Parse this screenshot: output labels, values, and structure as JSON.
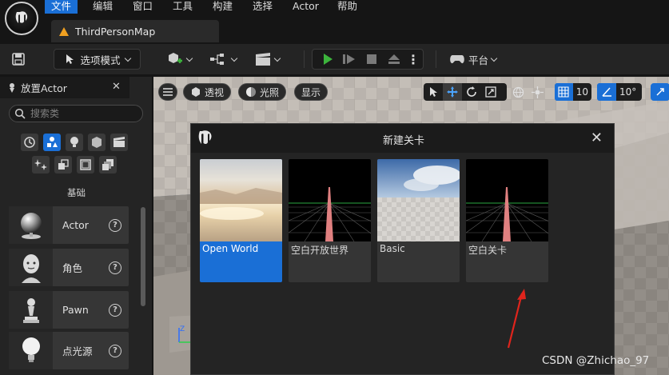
{
  "menu": {
    "items": [
      "文件",
      "编辑",
      "窗口",
      "工具",
      "构建",
      "选择",
      "Actor",
      "帮助"
    ]
  },
  "tab": {
    "title": "ThirdPersonMap"
  },
  "toolbar": {
    "mode_label": "选项模式",
    "platform_label": "平台"
  },
  "left_panel": {
    "title": "放置Actor",
    "search_placeholder": "搜索类",
    "section_label": "基础",
    "items": [
      {
        "label": "Actor",
        "icon": "sphere-icon"
      },
      {
        "label": "角色",
        "icon": "character-icon"
      },
      {
        "label": "Pawn",
        "icon": "pawn-icon"
      },
      {
        "label": "点光源",
        "icon": "light-bulb-icon"
      }
    ]
  },
  "viewport": {
    "perspective_label": "透视",
    "lit_label": "光照",
    "show_label": "显示",
    "grid_snap_value": "10",
    "rotation_snap_value": "10°"
  },
  "dialog": {
    "title": "新建关卡",
    "templates": [
      {
        "label": "Open World",
        "selected": true
      },
      {
        "label": "空白开放世界",
        "selected": false
      },
      {
        "label": "Basic",
        "selected": false
      },
      {
        "label": "空白关卡",
        "selected": false
      }
    ]
  },
  "watermark": "CSDN @Zhichao_97",
  "colors": {
    "accent": "#1a6fd6",
    "play_green": "#3cb43c",
    "annotation_arrow": "#e0241c"
  }
}
